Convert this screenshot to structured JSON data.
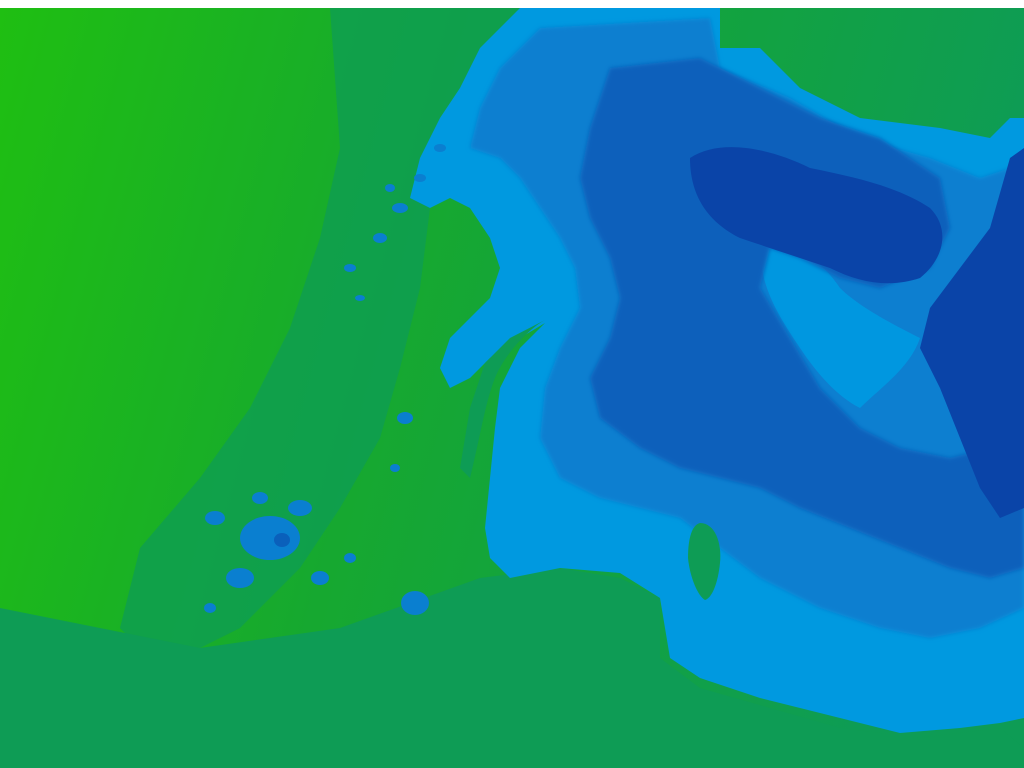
{
  "map": {
    "kind": "elevation-bathymetry-colormap",
    "icon": "terrain-map-icon",
    "colors": {
      "land_low": "#1fbf12",
      "land_mid": "#16a830",
      "land_high": "#0e9c55",
      "water_shallow": "#0099e0",
      "water_mid": "#0a7fd0",
      "water_deep": "#0a60bb",
      "water_deepest": "#0a44a8"
    }
  }
}
